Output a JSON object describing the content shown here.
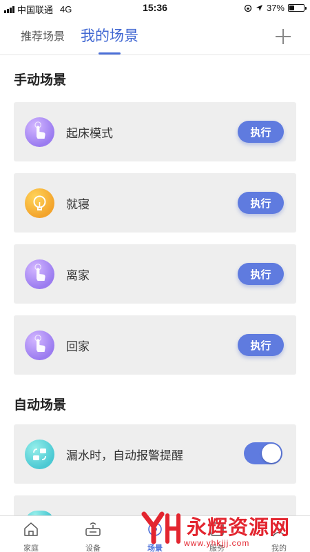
{
  "status_bar": {
    "carrier": "中国联通",
    "network": "4G",
    "time": "15:36",
    "battery": "37%",
    "battery_level": 0.37
  },
  "tabs": {
    "recommend_label": "推荐场景",
    "mine_label": "我的场景",
    "active": "我的场景"
  },
  "manual_section": {
    "title": "手动场景",
    "scenes": [
      {
        "label": "起床模式",
        "icon": "hand-tap-icon",
        "color": "#a98af2",
        "action": "执行"
      },
      {
        "label": "就寝",
        "icon": "lightbulb-icon",
        "color": "#f2a93a",
        "action": "执行"
      },
      {
        "label": "离家",
        "icon": "hand-tap-icon",
        "color": "#a98af2",
        "action": "执行"
      },
      {
        "label": "回家",
        "icon": "hand-tap-icon",
        "color": "#a98af2",
        "action": "执行"
      }
    ]
  },
  "auto_section": {
    "title": "自动场景",
    "scenes": [
      {
        "label": "漏水时，自动报警提醒",
        "icon": "swap-arrows-icon",
        "color": "#5fd3d8",
        "enabled": true
      },
      {
        "label": "",
        "icon": "scene-icon",
        "color": "#5fd3d8"
      }
    ]
  },
  "bottom_nav": {
    "items": [
      {
        "label": "家庭",
        "icon": "home-icon"
      },
      {
        "label": "设备",
        "icon": "router-icon"
      },
      {
        "label": "场景",
        "icon": "scene-icon",
        "active": true
      },
      {
        "label": "服务",
        "icon": "service-icon"
      },
      {
        "label": "我的",
        "icon": "profile-icon"
      }
    ]
  },
  "watermark": {
    "text": "永辉资源网",
    "url": "www.yhkjjj.com"
  },
  "colors": {
    "accent": "#4a6fd8",
    "button": "#5f7bdf",
    "card_bg": "#eeeeee",
    "watermark": "#e3252f"
  }
}
